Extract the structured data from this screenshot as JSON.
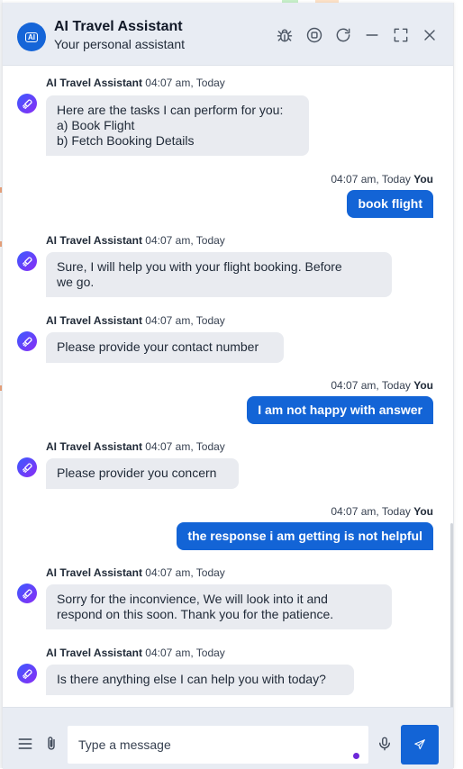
{
  "header": {
    "title": "AI Travel Assistant",
    "subtitle": "Your personal assistant",
    "logo_text": "AI"
  },
  "icons": {
    "debug": "bug-icon",
    "stop": "stop-circle-icon",
    "refresh": "refresh-icon",
    "minimize": "minimize-icon",
    "expand": "expand-icon",
    "close": "close-icon",
    "menu": "hamburger-menu-icon",
    "attach": "paperclip-icon",
    "mic": "microphone-icon",
    "send": "send-icon",
    "bot_avatar": "rocket-icon"
  },
  "colors": {
    "accent": "#1364d6",
    "header_bg": "#e8ecf3",
    "bot_bubble": "#e9ebf0",
    "typing_dot": "#6d28d9"
  },
  "messages": [
    {
      "from": "bot",
      "name": "AI Travel Assistant",
      "time": "04:07 am, Today",
      "lines": [
        "Here are the tasks I can perform for you:",
        "a) Book Flight",
        "b) Fetch Booking Details"
      ]
    },
    {
      "from": "user",
      "name": "You",
      "time": "04:07 am, Today",
      "text": "book flight"
    },
    {
      "from": "bot",
      "name": "AI Travel Assistant",
      "time": "04:07 am, Today",
      "lines": [
        "Sure, I will help you with your flight booking. Before",
        "we go."
      ]
    },
    {
      "from": "bot",
      "name": "AI Travel Assistant",
      "time": "04:07 am, Today",
      "lines": [
        "Please provide your contact number"
      ]
    },
    {
      "from": "user",
      "name": "You",
      "time": "04:07 am, Today",
      "text": "I am not happy with answer"
    },
    {
      "from": "bot",
      "name": "AI Travel Assistant",
      "time": "04:07 am, Today",
      "lines": [
        "Please provider you concern"
      ]
    },
    {
      "from": "user",
      "name": "You",
      "time": "04:07 am, Today",
      "text": "the response i am getting is not helpful"
    },
    {
      "from": "bot",
      "name": "AI Travel Assistant",
      "time": "04:07 am, Today",
      "lines": [
        "Sorry for the inconvience, We will look into it and",
        "respond on this soon. Thank you for the patience."
      ]
    },
    {
      "from": "bot",
      "name": "AI Travel Assistant",
      "time": "04:07 am, Today",
      "lines": [
        "Is there anything else I can help you with today?"
      ]
    }
  ],
  "composer": {
    "placeholder": "Type a message",
    "value": ""
  }
}
